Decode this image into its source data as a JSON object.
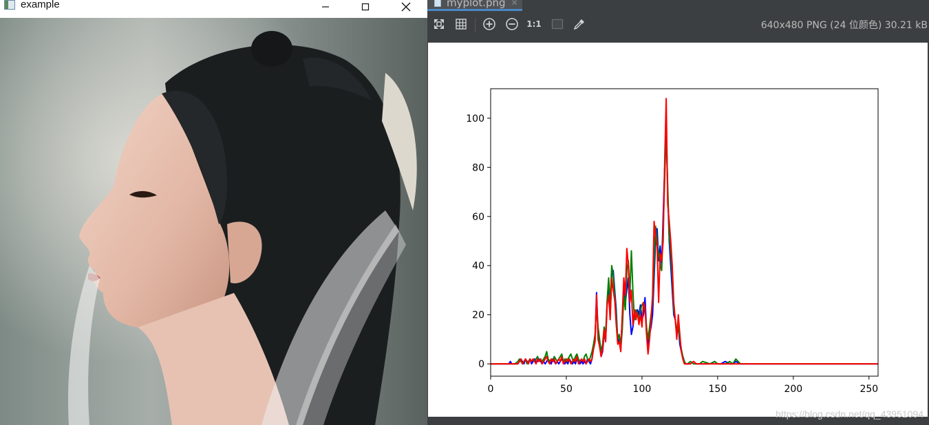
{
  "left_window": {
    "title": "example",
    "icon": "image-window-icon",
    "controls": [
      "minimize-icon",
      "maximize-icon",
      "close-icon"
    ],
    "photo_icon": "portrait-photo"
  },
  "viewer": {
    "tab_label": "myplot.png",
    "image_info": "640x480 PNG (24 位颜色) 30.21 kB",
    "zoom_actual_label": "1:1",
    "toolbar_icons": [
      "fit-zoom-icon",
      "grid-icon",
      "zoom-in-icon",
      "zoom-out-icon",
      "actual-size-icon",
      "background-icon",
      "color-picker-icon"
    ],
    "watermark": "https://blog.csdn.net/qq_43951094"
  },
  "chart_data": {
    "type": "line",
    "title": "",
    "xlabel": "",
    "ylabel": "",
    "xlim": [
      0,
      256
    ],
    "ylim": [
      -5,
      112
    ],
    "xticks": [
      0,
      50,
      100,
      150,
      200,
      250
    ],
    "yticks": [
      0,
      20,
      40,
      60,
      80,
      100
    ],
    "grid": false,
    "x": [
      0,
      5,
      10,
      12,
      13,
      14,
      16,
      18,
      19,
      20,
      21,
      22,
      23,
      24,
      25,
      26,
      27,
      28,
      29,
      30,
      31,
      32,
      33,
      34,
      35,
      36,
      37,
      38,
      39,
      40,
      41,
      42,
      43,
      44,
      45,
      46,
      47,
      48,
      49,
      50,
      51,
      52,
      53,
      54,
      55,
      56,
      57,
      58,
      59,
      60,
      61,
      62,
      63,
      64,
      65,
      66,
      67,
      68,
      69,
      70,
      71,
      72,
      73,
      74,
      75,
      76,
      77,
      78,
      79,
      80,
      81,
      82,
      83,
      84,
      85,
      86,
      87,
      88,
      89,
      90,
      91,
      92,
      93,
      94,
      95,
      96,
      97,
      98,
      99,
      100,
      101,
      102,
      103,
      104,
      105,
      106,
      107,
      108,
      109,
      110,
      111,
      112,
      113,
      114,
      115,
      116,
      117,
      118,
      119,
      120,
      121,
      122,
      123,
      124,
      125,
      126,
      127,
      128,
      129,
      130,
      132,
      134,
      136,
      138,
      140,
      145,
      148,
      150,
      152,
      155,
      158,
      160,
      162,
      165,
      167,
      170,
      180,
      200,
      220,
      240,
      256
    ],
    "series": [
      {
        "color": "#0000ff",
        "values": [
          0,
          0,
          0,
          0,
          1,
          0,
          0,
          0,
          1,
          2,
          1,
          0,
          2,
          1,
          1,
          2,
          0,
          1,
          2,
          1,
          1,
          2,
          1,
          0,
          1,
          0,
          1,
          2,
          1,
          0,
          2,
          1,
          0,
          1,
          0,
          1,
          2,
          1,
          0,
          1,
          0,
          2,
          1,
          0,
          1,
          0,
          2,
          1,
          0,
          1,
          0,
          1,
          0,
          2,
          1,
          0,
          2,
          7,
          10,
          29,
          12,
          8,
          3,
          5,
          12,
          10,
          25,
          30,
          20,
          36,
          38,
          30,
          22,
          9,
          10,
          8,
          18,
          32,
          25,
          30,
          35,
          20,
          12,
          15,
          20,
          18,
          22,
          20,
          24,
          18,
          20,
          27,
          14,
          8,
          12,
          15,
          20,
          35,
          50,
          55,
          42,
          48,
          40,
          60,
          80,
          95,
          70,
          50,
          40,
          30,
          20,
          18,
          12,
          15,
          8,
          5,
          3,
          1,
          0,
          0,
          0,
          1,
          0,
          0,
          0,
          0,
          1,
          0,
          0,
          1,
          0,
          0,
          1,
          0,
          0,
          0,
          0,
          0,
          0,
          0,
          0
        ]
      },
      {
        "color": "#008000",
        "values": [
          0,
          0,
          0,
          0,
          0,
          0,
          0,
          1,
          2,
          1,
          0,
          1,
          2,
          0,
          1,
          2,
          1,
          2,
          1,
          2,
          3,
          1,
          2,
          1,
          2,
          3,
          5,
          2,
          1,
          2,
          1,
          3,
          2,
          1,
          2,
          3,
          4,
          1,
          2,
          1,
          2,
          3,
          4,
          2,
          1,
          3,
          4,
          2,
          1,
          2,
          1,
          3,
          4,
          2,
          1,
          3,
          5,
          8,
          12,
          25,
          15,
          10,
          5,
          8,
          15,
          12,
          26,
          35,
          24,
          40,
          36,
          28,
          20,
          10,
          12,
          6,
          14,
          28,
          22,
          38,
          42,
          28,
          46,
          30,
          18,
          22,
          20,
          18,
          22,
          24,
          25,
          22,
          15,
          10,
          15,
          20,
          25,
          40,
          56,
          50,
          45,
          40,
          38,
          55,
          75,
          96,
          72,
          52,
          45,
          35,
          22,
          18,
          14,
          15,
          10,
          6,
          3,
          1,
          0,
          0,
          1,
          0,
          0,
          0,
          1,
          0,
          1,
          0,
          0,
          0,
          1,
          0,
          2,
          0,
          0,
          0,
          0,
          0,
          0,
          0,
          0
        ]
      },
      {
        "color": "#ff0000",
        "values": [
          0,
          0,
          0,
          0,
          0,
          0,
          0,
          0,
          1,
          2,
          0,
          1,
          2,
          1,
          0,
          2,
          1,
          2,
          1,
          0,
          2,
          1,
          2,
          0,
          1,
          2,
          3,
          1,
          0,
          2,
          1,
          2,
          0,
          1,
          2,
          1,
          3,
          0,
          1,
          2,
          1,
          2,
          0,
          1,
          2,
          1,
          3,
          0,
          1,
          2,
          1,
          2,
          0,
          1,
          2,
          1,
          2,
          6,
          9,
          28,
          10,
          7,
          3,
          6,
          14,
          9,
          24,
          28,
          18,
          35,
          30,
          26,
          16,
          8,
          9,
          5,
          20,
          35,
          28,
          47,
          40,
          25,
          30,
          16,
          22,
          18,
          21,
          16,
          20,
          15,
          25,
          23,
          12,
          4,
          10,
          18,
          28,
          58,
          52,
          48,
          25,
          45,
          42,
          50,
          82,
          108,
          65,
          58,
          50,
          40,
          25,
          18,
          10,
          20,
          12,
          5,
          2,
          0,
          0,
          0,
          0,
          1,
          0,
          0,
          0,
          0,
          0,
          0,
          0,
          0,
          0,
          0,
          0,
          0,
          0,
          0,
          0,
          0,
          0,
          0,
          0
        ]
      }
    ]
  }
}
